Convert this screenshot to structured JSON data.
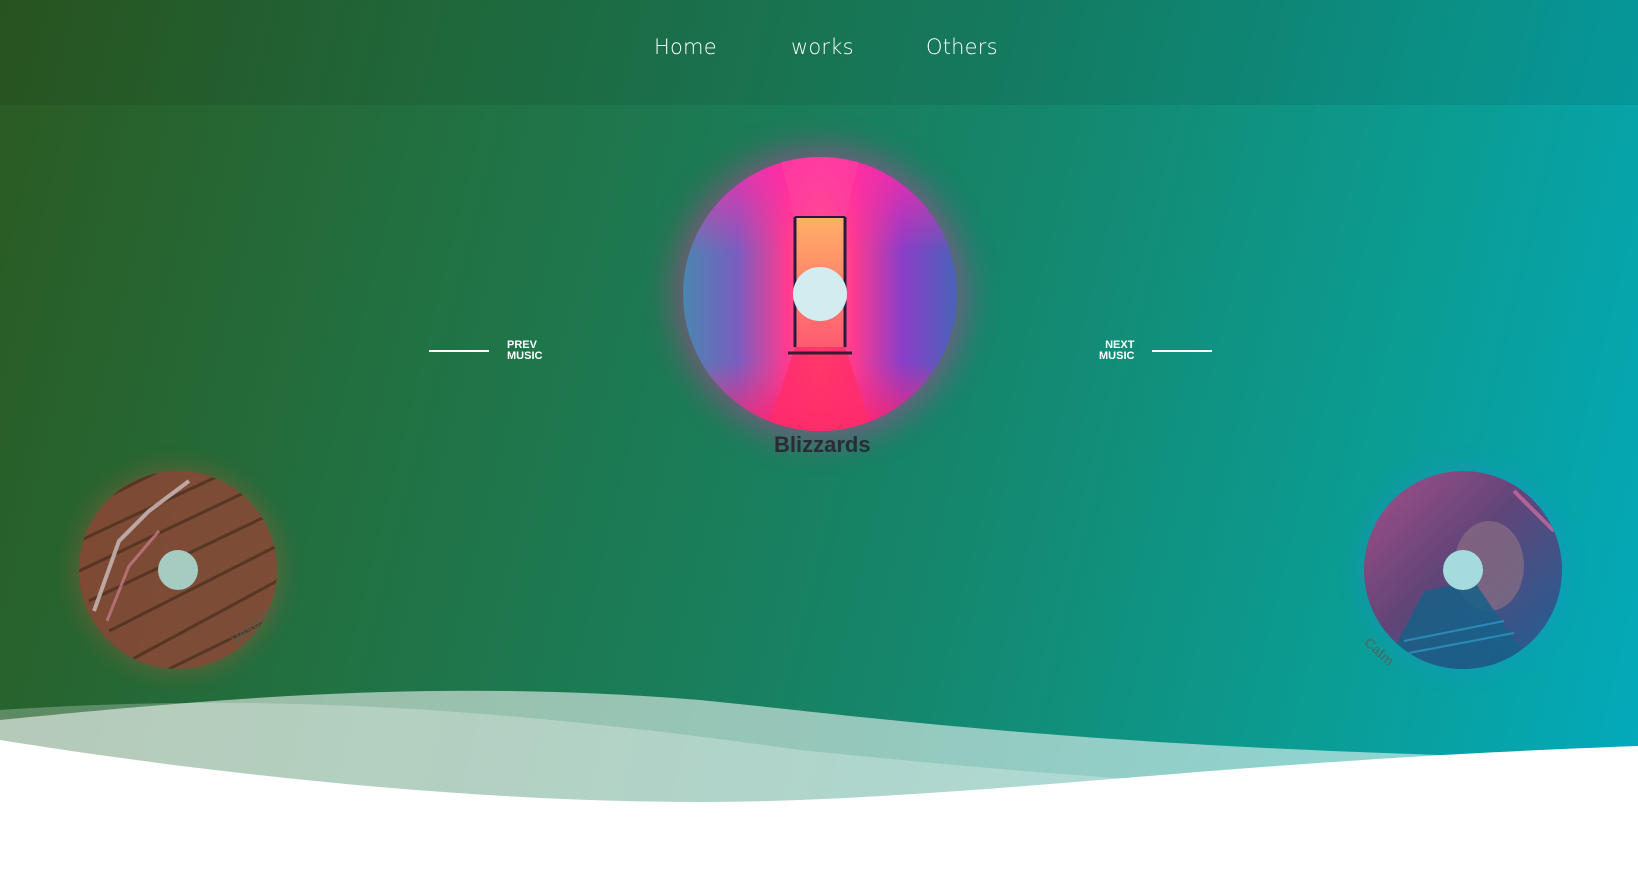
{
  "nav": {
    "items": [
      {
        "label": "Home"
      },
      {
        "label": "works"
      },
      {
        "label": "Others"
      }
    ]
  },
  "player": {
    "current": {
      "title": "Blizzards"
    },
    "previous": {
      "title": "Vespers"
    },
    "next": {
      "title": "Calm"
    },
    "prev_label": [
      "PREV",
      "MUSIC"
    ],
    "next_label": [
      "NEXT",
      "MUSIC"
    ]
  },
  "colors": {
    "bg_start": "#2b5a22",
    "bg_end": "#02abbe",
    "disc_hole": "#d2ecf0"
  },
  "icons": {
    "prev_control": "horizontal-line-icon",
    "next_control": "horizontal-line-icon"
  }
}
